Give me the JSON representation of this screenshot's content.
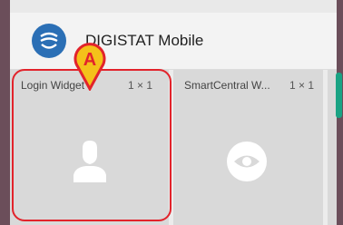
{
  "app": {
    "title": "DIGISTAT Mobile",
    "icon": "hands-care-icon"
  },
  "widgets": [
    {
      "name": "Login Widget",
      "size": "1 × 1",
      "icon": "user-silhouette-icon"
    },
    {
      "name": "SmartCentral W...",
      "size": "1 × 1",
      "icon": "eye-icon"
    }
  ],
  "annotation": {
    "label": "A",
    "color": "#e2232b",
    "fill": "#f4c11a"
  },
  "colors": {
    "accent_scroll": "#1aa384",
    "app_icon_bg": "#2b6fb5"
  }
}
